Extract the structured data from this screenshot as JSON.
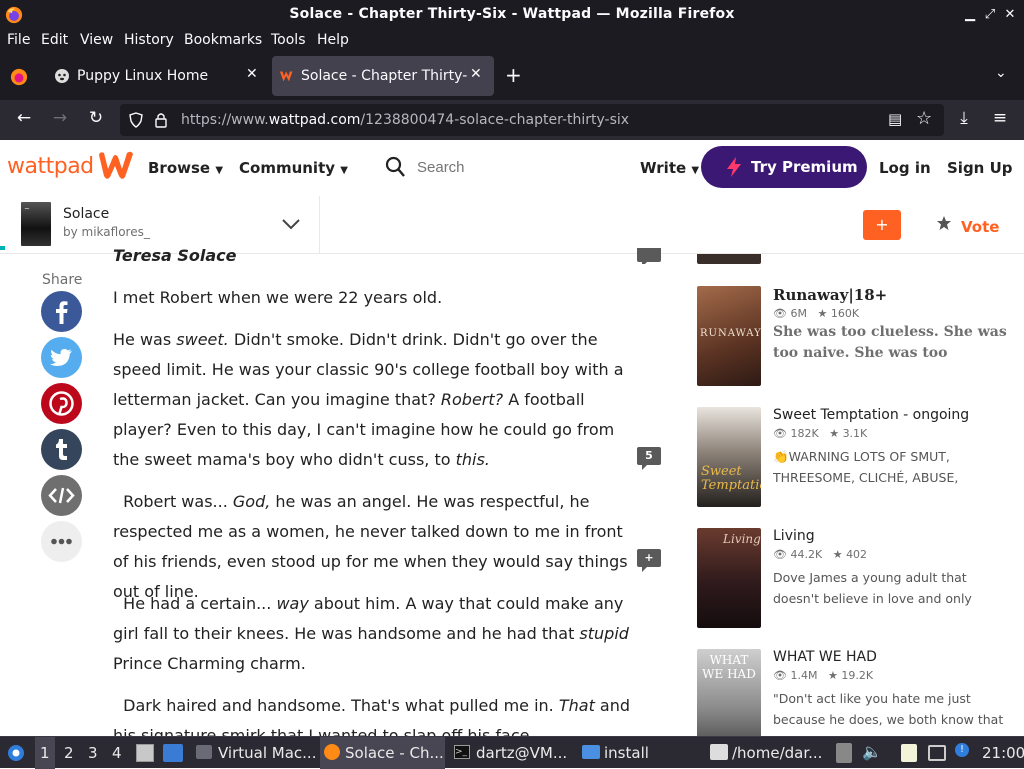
{
  "window": {
    "title": "Solace - Chapter Thirty-Six - Wattpad — Mozilla Firefox"
  },
  "menu": [
    "File",
    "Edit",
    "View",
    "History",
    "Bookmarks",
    "Tools",
    "Help"
  ],
  "tabs": [
    {
      "label": "Puppy Linux Home"
    },
    {
      "label": "Solace - Chapter Thirty-Six"
    }
  ],
  "address": {
    "prefix": "https://www.",
    "host": "wattpad.com",
    "path": "/1238800474-solace-chapter-thirty-six"
  },
  "wattpad": {
    "logo": "wattpad",
    "nav": {
      "browse": "Browse",
      "community": "Community"
    },
    "search_placeholder": "Search",
    "write": "Write",
    "premium": "Try Premium",
    "login": "Log in",
    "signup": "Sign Up"
  },
  "story": {
    "title": "Solace",
    "author": "by mikaflores_",
    "add": "+",
    "vote": "Vote"
  },
  "share": {
    "label": "Share",
    "buttons": [
      "facebook",
      "twitter",
      "pinterest",
      "tumblr",
      "embed",
      "more"
    ]
  },
  "content": {
    "author_line": "Teresa Solace",
    "paragraphs": [
      "I met Robert when we were 22 years old.",
      "He was <i>sweet.</i> Didn't smoke. Didn't drink. Didn't go over the speed limit. He was your classic 90's college football boy with a letterman jacket. Can you imagine that? <i>Robert?</i> A football player? Even to this day, I can't imagine how he could go from the sweet mama's boy who didn't cuss, to <i>this.</i>",
      "&nbsp;&nbsp;Robert was... <i>God,</i> he was an angel. He was respectful, he respected me as a women, he never talked down to me in front of his friends, even stood up for me when they would say things out of line.",
      "&nbsp;&nbsp;He had a certain... <i>way</i> about him. A way that could make any girl fall to their knees. He was handsome and he had that <i>stupid</i> Prince Charming charm.",
      "&nbsp;&nbsp;Dark haired and handsome. That's what pulled me in. <i>That</i> and his signature smirk that I wanted to slap off his face."
    ],
    "comment_counts": [
      "",
      "5",
      "+"
    ]
  },
  "sidebar": [
    {
      "title": "Runaway|18+",
      "reads": "6M",
      "votes": "160K",
      "desc": "She was too clueless. She was too naive. She was too",
      "cover_text": "RUNAWAY"
    },
    {
      "title": "Sweet Temptation - ongoing",
      "reads": "182K",
      "votes": "3.1K",
      "desc": "👏WARNING LOTS OF SMUT, THREESOME, CLICHÉ, ABUSE, TRAUMA,",
      "cover_text": "Sweet Temptation"
    },
    {
      "title": "Living",
      "reads": "44.2K",
      "votes": "402",
      "desc": "Dove James a young adult that doesn't believe in love and only thinks bad of",
      "cover_text": "Living"
    },
    {
      "title": "WHAT WE HAD",
      "reads": "1.4M",
      "votes": "19.2K",
      "desc": "&quot;Don't act like you hate me just because he does, we both know that",
      "cover_text": "WHAT WE HAD"
    }
  ],
  "taskbar": {
    "workspaces": [
      "1",
      "2",
      "3",
      "4"
    ],
    "items": [
      "Virtual Mac...",
      "Solace - Ch...",
      "dartz@VM...",
      "install",
      "/home/dar..."
    ],
    "clock": "21:00"
  }
}
